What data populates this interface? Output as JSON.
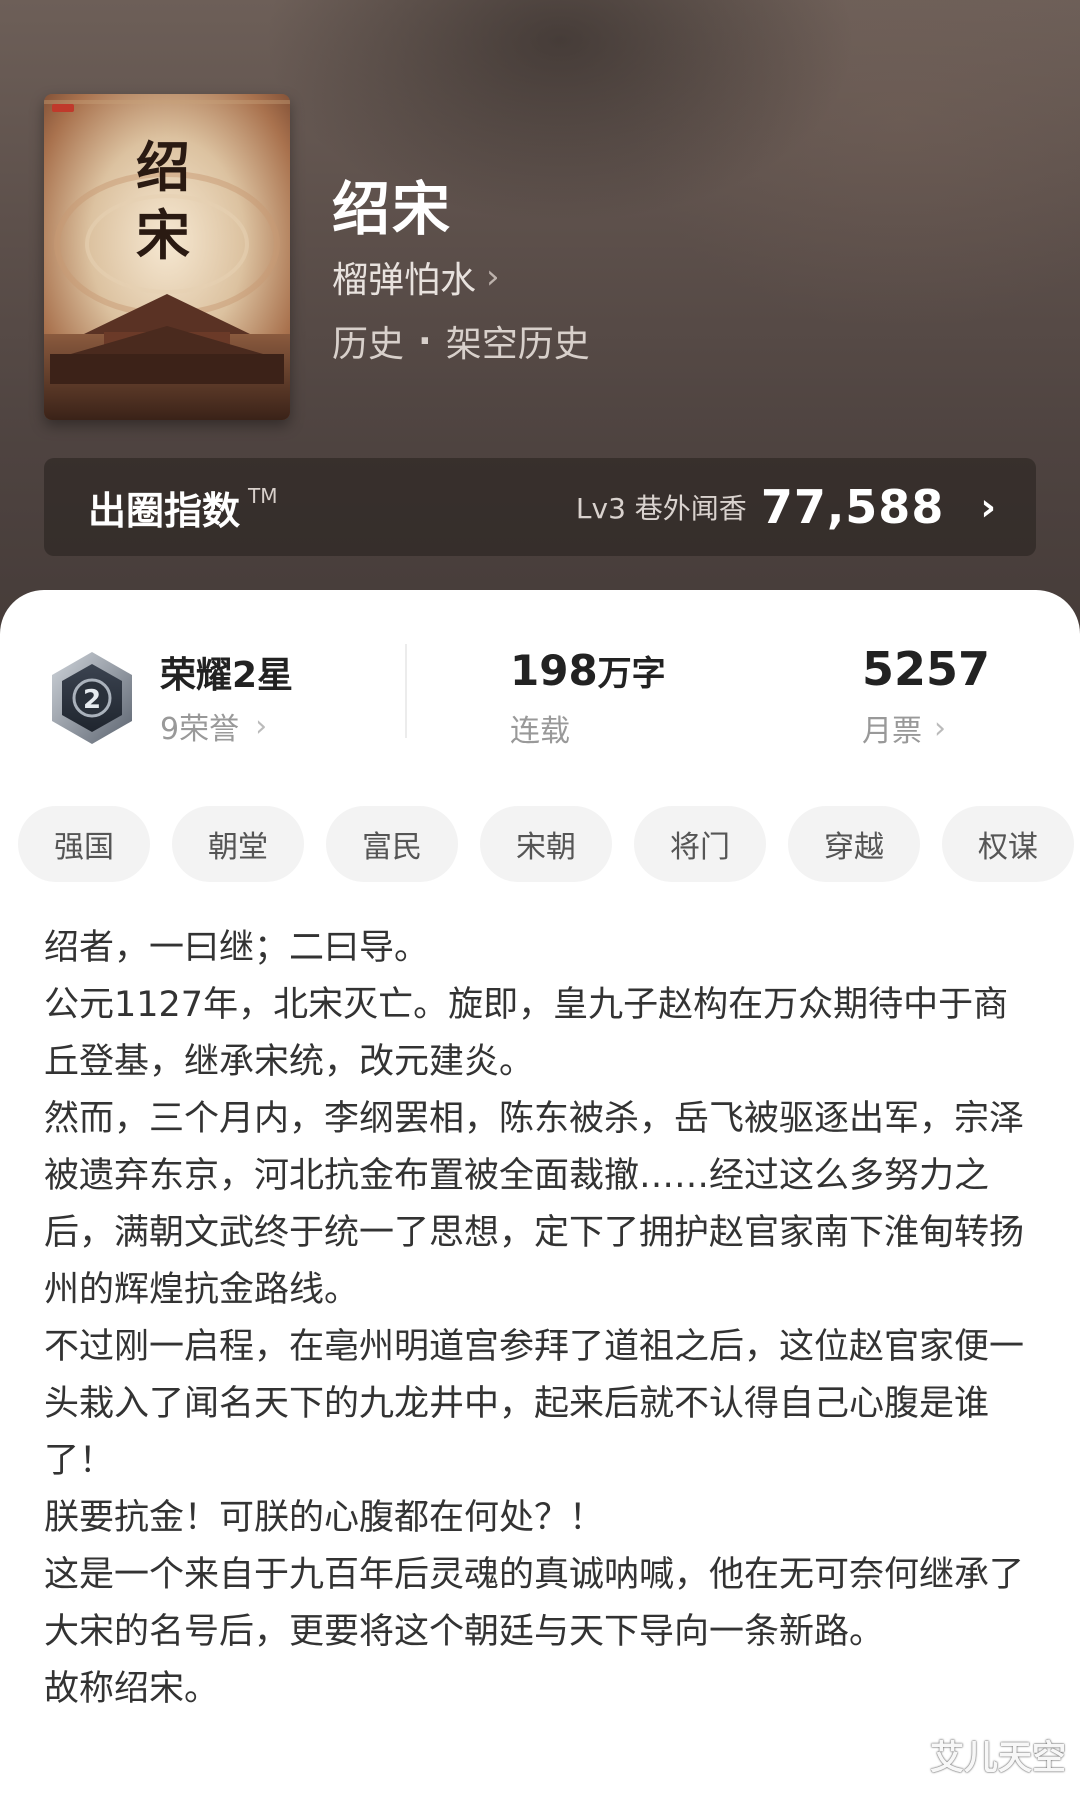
{
  "book": {
    "title": "绍宋",
    "author": "榴弹怕水",
    "category_main": "历史",
    "category_sub": "架空历史",
    "cover_title": "绍宋"
  },
  "index": {
    "label": "出圈指数",
    "tm": "TM",
    "level": "Lv3 巷外闻香",
    "value": "77,588"
  },
  "stats": {
    "honor_title": "荣耀2星",
    "honor_sub": "9荣誉",
    "badge_number": "2",
    "words_num": "198",
    "words_unit": "万字",
    "words_status": "连载",
    "tickets_num": "5257",
    "tickets_label": "月票"
  },
  "tags": [
    "强国",
    "朝堂",
    "富民",
    "宋朝",
    "将门",
    "穿越",
    "权谋"
  ],
  "description": [
    "绍者，一曰继；二曰导。",
    "公元1127年，北宋灭亡。旋即，皇九子赵构在万众期待中于商丘登基，继承宋统，改元建炎。",
    "然而，三个月内，李纲罢相，陈东被杀，岳飞被驱逐出军，宗泽被遗弃东京，河北抗金布置被全面裁撤……经过这么多努力之后，满朝文武终于统一了思想，定下了拥护赵官家南下淮甸转扬州的辉煌抗金路线。",
    "不过刚一启程，在亳州明道宫参拜了道祖之后，这位赵官家便一头栽入了闻名天下的九龙井中，起来后就不认得自己心腹是谁了！",
    "朕要抗金！可朕的心腹都在何处？！",
    "这是一个来自于九百年后灵魂的真诚呐喊，他在无可奈何继承了大宋的名号后，更要将这个朝廷与天下导向一条新路。",
    "故称绍宋。"
  ],
  "watermark": "艾儿天空",
  "icons": {
    "chevron": "chevron-right-icon",
    "badge": "honor-badge-icon"
  },
  "colors": {
    "header_bg": "#5d504b",
    "tag_bg": "#f3f3f3",
    "text_main": "#333333",
    "text_muted": "#999999"
  }
}
